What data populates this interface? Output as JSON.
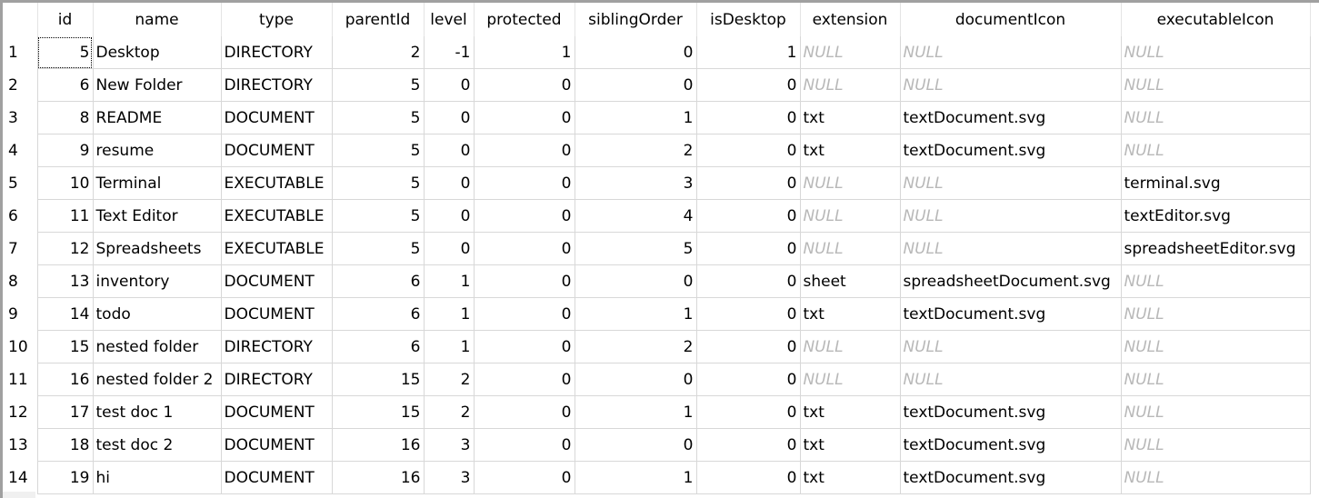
{
  "grid": {
    "columns": [
      "id",
      "name",
      "type",
      "parentId",
      "level",
      "protected",
      "siblingOrder",
      "isDesktop",
      "extension",
      "documentIcon",
      "executableIcon"
    ],
    "null_label": "NULL",
    "rows": [
      {
        "n": "1",
        "id": "5",
        "name": "Desktop",
        "type": "DIRECTORY",
        "parentId": "2",
        "level": "-1",
        "protected": "1",
        "siblingOrder": "0",
        "isDesktop": "1",
        "extension": null,
        "documentIcon": null,
        "executableIcon": null
      },
      {
        "n": "2",
        "id": "6",
        "name": "New Folder",
        "type": "DIRECTORY",
        "parentId": "5",
        "level": "0",
        "protected": "0",
        "siblingOrder": "0",
        "isDesktop": "0",
        "extension": null,
        "documentIcon": null,
        "executableIcon": null
      },
      {
        "n": "3",
        "id": "8",
        "name": "README",
        "type": "DOCUMENT",
        "parentId": "5",
        "level": "0",
        "protected": "0",
        "siblingOrder": "1",
        "isDesktop": "0",
        "extension": "txt",
        "documentIcon": "textDocument.svg",
        "executableIcon": null
      },
      {
        "n": "4",
        "id": "9",
        "name": "resume",
        "type": "DOCUMENT",
        "parentId": "5",
        "level": "0",
        "protected": "0",
        "siblingOrder": "2",
        "isDesktop": "0",
        "extension": "txt",
        "documentIcon": "textDocument.svg",
        "executableIcon": null
      },
      {
        "n": "5",
        "id": "10",
        "name": "Terminal",
        "type": "EXECUTABLE",
        "parentId": "5",
        "level": "0",
        "protected": "0",
        "siblingOrder": "3",
        "isDesktop": "0",
        "extension": null,
        "documentIcon": null,
        "executableIcon": "terminal.svg"
      },
      {
        "n": "6",
        "id": "11",
        "name": "Text Editor",
        "type": "EXECUTABLE",
        "parentId": "5",
        "level": "0",
        "protected": "0",
        "siblingOrder": "4",
        "isDesktop": "0",
        "extension": null,
        "documentIcon": null,
        "executableIcon": "textEditor.svg"
      },
      {
        "n": "7",
        "id": "12",
        "name": "Spreadsheets",
        "type": "EXECUTABLE",
        "parentId": "5",
        "level": "0",
        "protected": "0",
        "siblingOrder": "5",
        "isDesktop": "0",
        "extension": null,
        "documentIcon": null,
        "executableIcon": "spreadsheetEditor.svg"
      },
      {
        "n": "8",
        "id": "13",
        "name": "inventory",
        "type": "DOCUMENT",
        "parentId": "6",
        "level": "1",
        "protected": "0",
        "siblingOrder": "0",
        "isDesktop": "0",
        "extension": "sheet",
        "documentIcon": "spreadsheetDocument.svg",
        "executableIcon": null
      },
      {
        "n": "9",
        "id": "14",
        "name": "todo",
        "type": "DOCUMENT",
        "parentId": "6",
        "level": "1",
        "protected": "0",
        "siblingOrder": "1",
        "isDesktop": "0",
        "extension": "txt",
        "documentIcon": "textDocument.svg",
        "executableIcon": null
      },
      {
        "n": "10",
        "id": "15",
        "name": "nested folder",
        "type": "DIRECTORY",
        "parentId": "6",
        "level": "1",
        "protected": "0",
        "siblingOrder": "2",
        "isDesktop": "0",
        "extension": null,
        "documentIcon": null,
        "executableIcon": null
      },
      {
        "n": "11",
        "id": "16",
        "name": "nested folder 2",
        "type": "DIRECTORY",
        "parentId": "15",
        "level": "2",
        "protected": "0",
        "siblingOrder": "0",
        "isDesktop": "0",
        "extension": null,
        "documentIcon": null,
        "executableIcon": null
      },
      {
        "n": "12",
        "id": "17",
        "name": "test doc 1",
        "type": "DOCUMENT",
        "parentId": "15",
        "level": "2",
        "protected": "0",
        "siblingOrder": "1",
        "isDesktop": "0",
        "extension": "txt",
        "documentIcon": "textDocument.svg",
        "executableIcon": null
      },
      {
        "n": "13",
        "id": "18",
        "name": "test doc 2",
        "type": "DOCUMENT",
        "parentId": "16",
        "level": "3",
        "protected": "0",
        "siblingOrder": "0",
        "isDesktop": "0",
        "extension": "txt",
        "documentIcon": "textDocument.svg",
        "executableIcon": null
      },
      {
        "n": "14",
        "id": "19",
        "name": "hi",
        "type": "DOCUMENT",
        "parentId": "16",
        "level": "3",
        "protected": "0",
        "siblingOrder": "1",
        "isDesktop": "0",
        "extension": "txt",
        "documentIcon": "textDocument.svg",
        "executableIcon": null
      }
    ]
  }
}
